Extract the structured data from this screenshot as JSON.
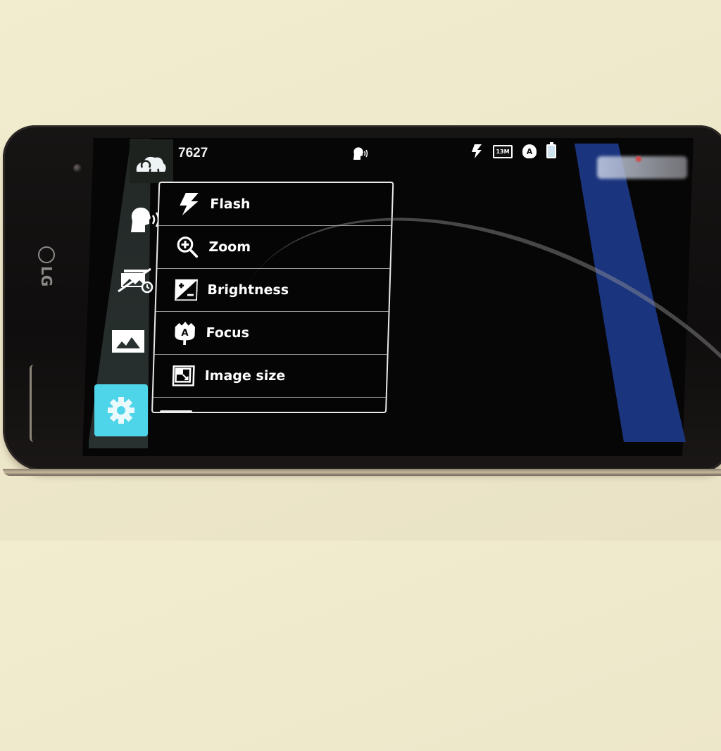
{
  "device": {
    "brand_logo": "LG"
  },
  "status_bar": {
    "shot_count": "7627",
    "icons": [
      {
        "name": "voice-shutter-icon",
        "glyph": "voice"
      },
      {
        "name": "flash-icon",
        "glyph": "⚡"
      },
      {
        "name": "resolution-icon",
        "label": "13M"
      },
      {
        "name": "auto-focus-icon",
        "label": "A"
      },
      {
        "name": "battery-icon",
        "glyph": "battery"
      }
    ]
  },
  "toolbar": {
    "items": [
      {
        "name": "camera-switch",
        "icon": "camera-rotate-icon"
      },
      {
        "name": "voice-shutter",
        "icon": "voice-shutter-icon"
      },
      {
        "name": "time-machine",
        "icon": "time-catch-shot-icon"
      },
      {
        "name": "gallery",
        "icon": "gallery-icon"
      },
      {
        "name": "settings",
        "icon": "gear-icon",
        "active": true
      }
    ],
    "accent_color": "#4fd5ea"
  },
  "settings_menu": {
    "items": [
      {
        "label": "Flash",
        "icon": "flash-icon"
      },
      {
        "label": "Zoom",
        "icon": "zoom-in-icon"
      },
      {
        "label": "Brightness",
        "icon": "brightness-icon"
      },
      {
        "label": "Focus",
        "icon": "focus-auto-icon",
        "badge": "A"
      },
      {
        "label": "Image size",
        "icon": "image-size-icon"
      }
    ]
  },
  "shutter_panel": {
    "color": "#1e3a8c"
  }
}
